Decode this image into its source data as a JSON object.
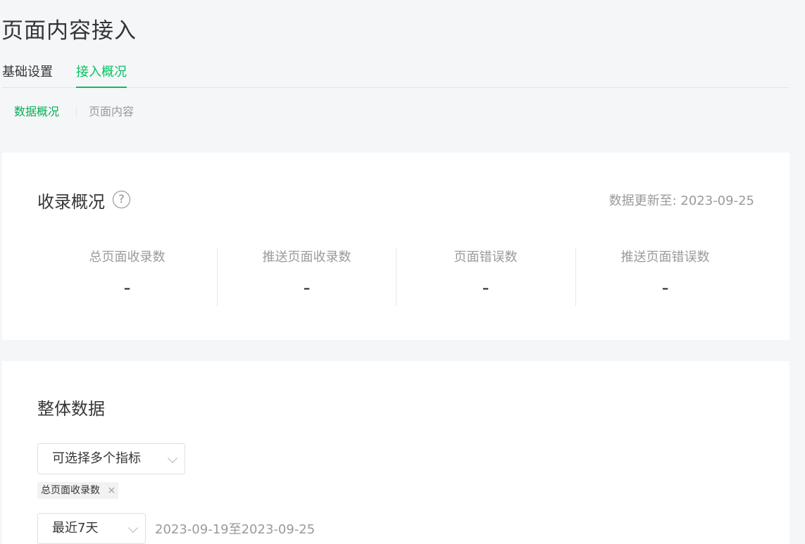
{
  "page_title": "页面内容接入",
  "main_tabs": [
    {
      "label": "基础设置"
    },
    {
      "label": "接入概况"
    }
  ],
  "sub_tabs": [
    {
      "label": "数据概况"
    },
    {
      "label": "页面内容"
    }
  ],
  "overview": {
    "title": "收录概况",
    "help_icon": "?",
    "update_text": "数据更新至: 2023-09-25",
    "stats": [
      {
        "label": "总页面收录数",
        "value": "-"
      },
      {
        "label": "推送页面收录数",
        "value": "-"
      },
      {
        "label": "页面错误数",
        "value": "-"
      },
      {
        "label": "推送页面错误数",
        "value": "-"
      }
    ]
  },
  "overall": {
    "title": "整体数据",
    "metric_select_placeholder": "可选择多个指标",
    "selected_tag": "总页面收录数",
    "tag_close": "×",
    "range_select": "最近7天",
    "range_text": "2023-09-19至2023-09-25"
  },
  "colors": {
    "accent": "#07c160",
    "active_sub": "#06ae56",
    "background": "#f5f6f8",
    "muted_text": "#9a9a9a"
  }
}
